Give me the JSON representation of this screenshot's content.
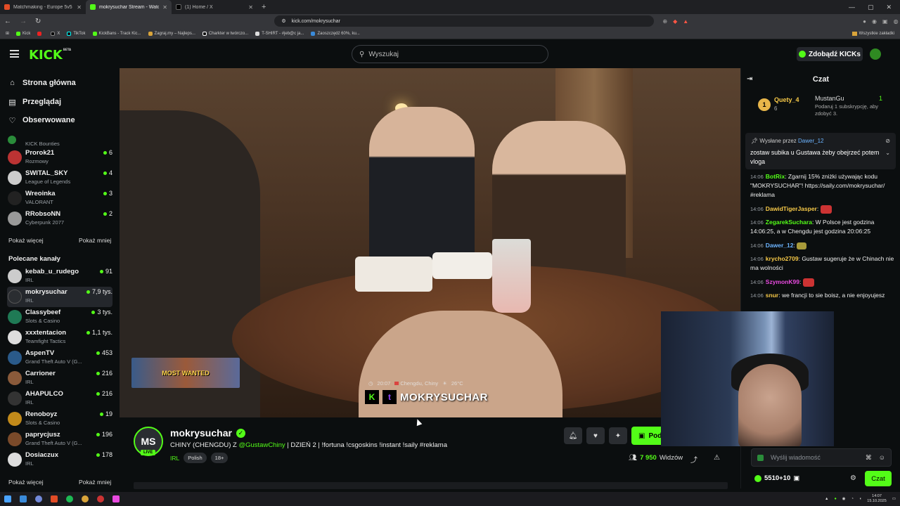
{
  "browser": {
    "tabs": [
      {
        "title": "Matchmaking - Europe 5v5 Queue -",
        "active": false,
        "color": "#e24c26"
      },
      {
        "title": "mokrysuchar Stream - Watch Liv",
        "active": true,
        "color": "#53fc18"
      },
      {
        "title": "(1) Home / X",
        "active": false,
        "color": "#ffffff"
      }
    ],
    "new_tab_label": "+",
    "url": "kick.com/mokrysuchar",
    "bookmarks": [
      "Kick",
      "",
      "X",
      "TikTok",
      "KickBans - Track Kic...",
      "Zagraj.my – Najleps...",
      "Charkter w twórczo...",
      "T-SHIRT - #jeb@c ja...",
      "Zaoszczędź 60%, ku..."
    ],
    "all_bookmarks_label": "Wszystkie zakładki"
  },
  "header": {
    "logo_text": "KICK",
    "logo_beta": "BETA",
    "search_placeholder": "Wyszukaj",
    "get_kicks_label": "Zdobądź KICKs"
  },
  "sidebar": {
    "nav": [
      {
        "label": "Strona główna",
        "icon": "home-icon"
      },
      {
        "label": "Przeglądaj",
        "icon": "browse-icon"
      },
      {
        "label": "Obserwowane",
        "icon": "heart-icon"
      }
    ],
    "followed": [
      {
        "name": "",
        "category": "KICK Bounties",
        "viewers": "",
        "color": "#2a8c3a"
      },
      {
        "name": "Prorok21",
        "category": "Rozmowy",
        "viewers": "6",
        "color": "#b33"
      },
      {
        "name": "SWITAL_SKY",
        "category": "League of Legends",
        "viewers": "4",
        "color": "#ccc"
      },
      {
        "name": "Wreoinka",
        "category": "VALORANT",
        "viewers": "3",
        "color": "#222"
      },
      {
        "name": "RRobsoNN",
        "category": "Cyberpunk 2077",
        "viewers": "2",
        "color": "#999"
      }
    ],
    "show_more": "Pokaż więcej",
    "show_less": "Pokaż mniej",
    "recommended_title": "Polecane kanały",
    "recommended": [
      {
        "name": "kebab_u_rudego",
        "category": "IRL",
        "viewers": "91",
        "color": "#ccc"
      },
      {
        "name": "mokrysuchar",
        "category": "IRL",
        "viewers": "7,9 tys.",
        "color": "#2a2d31",
        "selected": true
      },
      {
        "name": "Classybeef",
        "category": "Slots & Casino",
        "viewers": "3 tys.",
        "color": "#1f7a55"
      },
      {
        "name": "xxxtentacion",
        "category": "Teamfight Tactics",
        "viewers": "1,1 tys.",
        "color": "#ddd"
      },
      {
        "name": "AspenTV",
        "category": "Grand Theft Auto V (G...",
        "viewers": "453",
        "color": "#2a5a8a"
      },
      {
        "name": "Carrioner",
        "category": "IRL",
        "viewers": "216",
        "color": "#8a5a3a"
      },
      {
        "name": "AHAPULCO",
        "category": "IRL",
        "viewers": "216",
        "color": "#333"
      },
      {
        "name": "Renoboyz",
        "category": "Slots & Casino",
        "viewers": "19",
        "color": "#c28a1a"
      },
      {
        "name": "paprycjusz",
        "category": "Grand Theft Auto V (G...",
        "viewers": "196",
        "color": "#7a4a2a"
      },
      {
        "name": "Dosiaczux",
        "category": "IRL",
        "viewers": "178",
        "color": "#ddd"
      }
    ]
  },
  "video": {
    "banner_text": "MOST WANTED",
    "overlay_time": "20:07",
    "overlay_location": "Chengdu, Chiny",
    "overlay_temp": "26°C",
    "overlay_name": "MOKRYSUCHAR"
  },
  "stream": {
    "avatar_initials": "MS",
    "live_label": "LIVE",
    "channel_name": "mokrysuchar",
    "title_prefix": "CHINY (CHENGDU) Z ",
    "title_mention": "@GustawChiny",
    "title_suffix": " | DZIEŃ 2 | !fortuna !csgoskins !instant !saily #reklama",
    "category": "IRL",
    "tags": [
      "Polish",
      "18+"
    ],
    "subscribe_label": "Pod",
    "viewers": "7 950",
    "viewers_label": "Widzów"
  },
  "chat": {
    "title": "Czat",
    "leaderboard": {
      "rank": "1",
      "top_user": "Quety_4",
      "top_count": "6",
      "second_user": "MustanGu",
      "second_count": "1",
      "second_hint": "Podaruj 1 subskrypcję, aby zdobyć 3."
    },
    "pinned_by_label": "Wysłane przez",
    "pinned_by_user": "Dawer_12",
    "pinned_message": "zostaw subika u Gustawa żeby obejrzeć potem vloga",
    "messages": [
      {
        "time": "14:06",
        "user": "BotRix",
        "color": "#53fc18",
        "text": "Zgarnij 15% zniżki używając kodu \"MOKRYSUCHAR\"! https://saily.com/mokrysuchar/ #reklama"
      },
      {
        "time": "14:06",
        "user": "DawidTigerJasper",
        "color": "#f7c948",
        "text": ""
      },
      {
        "time": "14:06",
        "user": "ZegarekSuchara",
        "color": "#53fc18",
        "text": "W Polsce jest godzina 14:06:25, a w Chengdu jest godzina 20:06:25"
      },
      {
        "time": "14:06",
        "user": "Dawer_12",
        "color": "#6cb4ff",
        "text": ""
      },
      {
        "time": "14:06",
        "user": "krycho2709",
        "color": "#f7c948",
        "text": "Gustaw sugeruje że w Chinach nie ma wolności"
      },
      {
        "time": "14:06",
        "user": "SzymonK99",
        "color": "#e94ae0",
        "text": ""
      },
      {
        "time": "14:06",
        "user": "snur",
        "color": "#f7c948",
        "text": "we francji to sie boisz, a nie enjoyujesz"
      }
    ],
    "input_placeholder": "Wyślij wiadomość",
    "kicks_balance": "5510+10",
    "send_label": "Czat"
  },
  "taskbar": {
    "time": "14:07",
    "date": "15.10.2025"
  }
}
